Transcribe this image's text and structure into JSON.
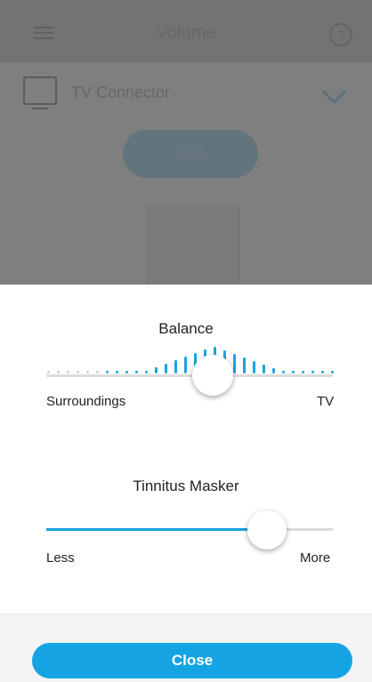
{
  "app": {
    "title": "Volume",
    "device_name": "TV Connector",
    "join_label": "Join",
    "icons": [
      "menu-icon",
      "help-icon",
      "tv-icon",
      "chevron-down-icon"
    ]
  },
  "balance": {
    "title": "Balance",
    "left_label": "Surroundings",
    "right_label": "TV",
    "level": 0.58,
    "active_color": "#1aa3e0",
    "inactive_color": "#d0d0d0"
  },
  "tinnitus": {
    "title": "Tinnitus Masker",
    "left_label": "Less",
    "right_label": "More",
    "level": 0.77,
    "fill_color": "#1aa3e0"
  },
  "footer": {
    "close_label": "Close",
    "accent": "#14a4e3"
  }
}
